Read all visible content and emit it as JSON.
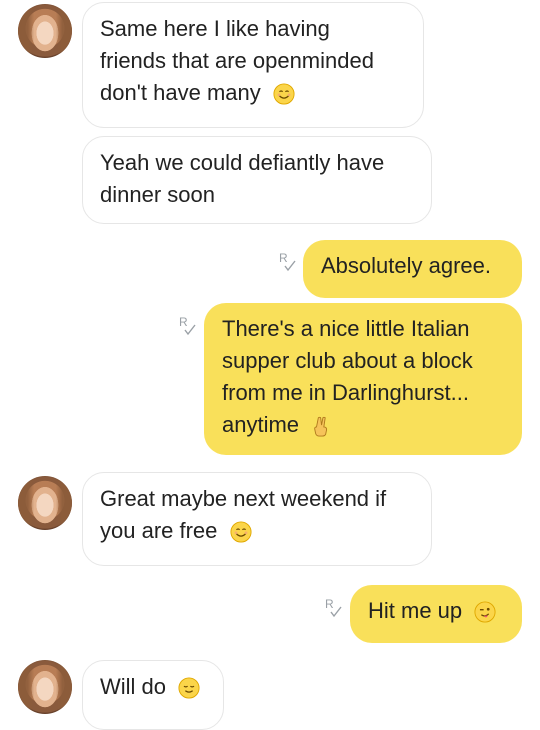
{
  "messages": [
    {
      "from": "them",
      "text_lines": [
        "Same here I like having",
        "friends that are openminded",
        "don't have many"
      ],
      "emoji": "smiling-face"
    },
    {
      "from": "them",
      "text_lines": [
        "Yeah we could defiantly have",
        "dinner soon"
      ]
    },
    {
      "from": "me",
      "text_lines": [
        "Absolutely agree."
      ],
      "status": "read"
    },
    {
      "from": "me",
      "text_lines": [
        "There's a nice little Italian",
        "supper club about a block",
        "from me in Darlinghurst...",
        "anytime"
      ],
      "emoji": "victory-hand",
      "status": "read"
    },
    {
      "from": "them",
      "text_lines": [
        "Great maybe next weekend if",
        "you are free"
      ],
      "emoji": "smiling-face"
    },
    {
      "from": "me",
      "text_lines": [
        "Hit me up"
      ],
      "emoji": "winking-face",
      "status": "read"
    },
    {
      "from": "them",
      "text_lines": [
        "Will do"
      ],
      "emoji": "relieved-face"
    }
  ],
  "colors": {
    "outgoing_bubble": "#f9e05a",
    "incoming_bubble": "#ffffff",
    "read_receipt": "#9aa0a6"
  }
}
